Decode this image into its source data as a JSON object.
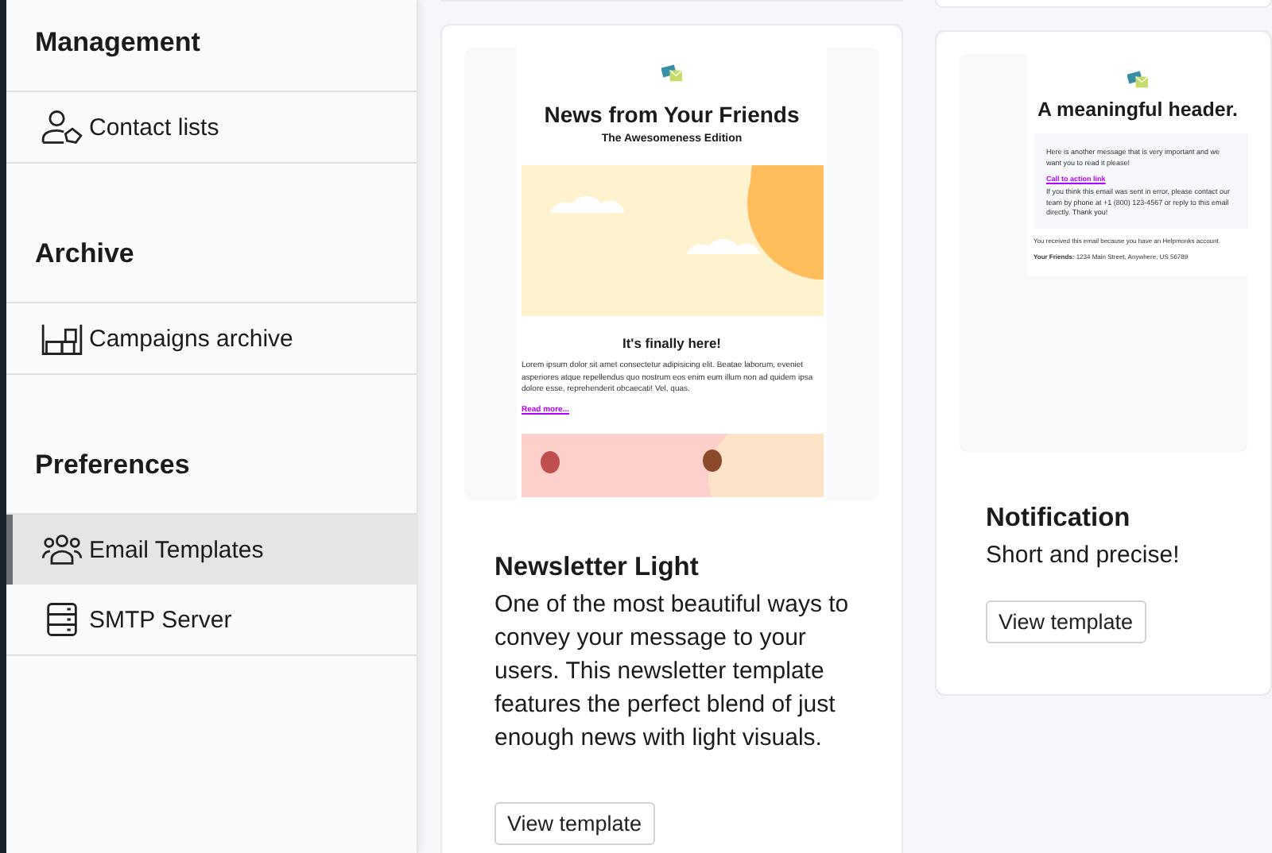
{
  "sidebar": {
    "sections": [
      {
        "heading": "Management",
        "items": [
          {
            "label": "Contact lists",
            "kind": "contacts",
            "selected": false
          }
        ]
      },
      {
        "heading": "Archive",
        "items": [
          {
            "label": "Campaigns archive",
            "kind": "archive",
            "selected": false
          }
        ]
      },
      {
        "heading": "Preferences",
        "items": [
          {
            "label": "Email Templates",
            "kind": "templates",
            "selected": true
          },
          {
            "label": "SMTP Server",
            "kind": "server",
            "selected": false
          }
        ]
      }
    ]
  },
  "templates": [
    {
      "name": "Newsletter Light",
      "description": "One of the most beautiful ways to convey your message to your users. This newsletter template features the perfect blend of just enough news with light visuals.",
      "button": "View template",
      "preview": {
        "kind": "newsletter",
        "title": "News from Your Friends",
        "subtitle": "The Awesomeness Edition",
        "heading": "It's finally here!",
        "body": "Lorem ipsum dolor sit amet consectetur adipisicing elit. Beatae laborum, eveniet asperiores atque repellendus quo nostrum eos enim eum illum non ad quidem ipsa dolore esse, reprehenderit obcaecati! Vel, quas.",
        "link": "Read more..."
      }
    },
    {
      "name": "Notification",
      "description": "Short and precise!",
      "button": "View template",
      "preview": {
        "kind": "notification",
        "title": "A meaningful header.",
        "message": "Here is another message that is very important and we want you to read it please!",
        "link": "Call to action link",
        "note": "If you think this email was sent in error, please contact our team by phone at +1 (800) 123-4567 or reply to this email directly. Thank you!",
        "footer": "You received this email because you have an Helpmonks account.",
        "address": "**Your Friends:** 1234 Main Street, Anywhere, US 56789"
      }
    }
  ]
}
